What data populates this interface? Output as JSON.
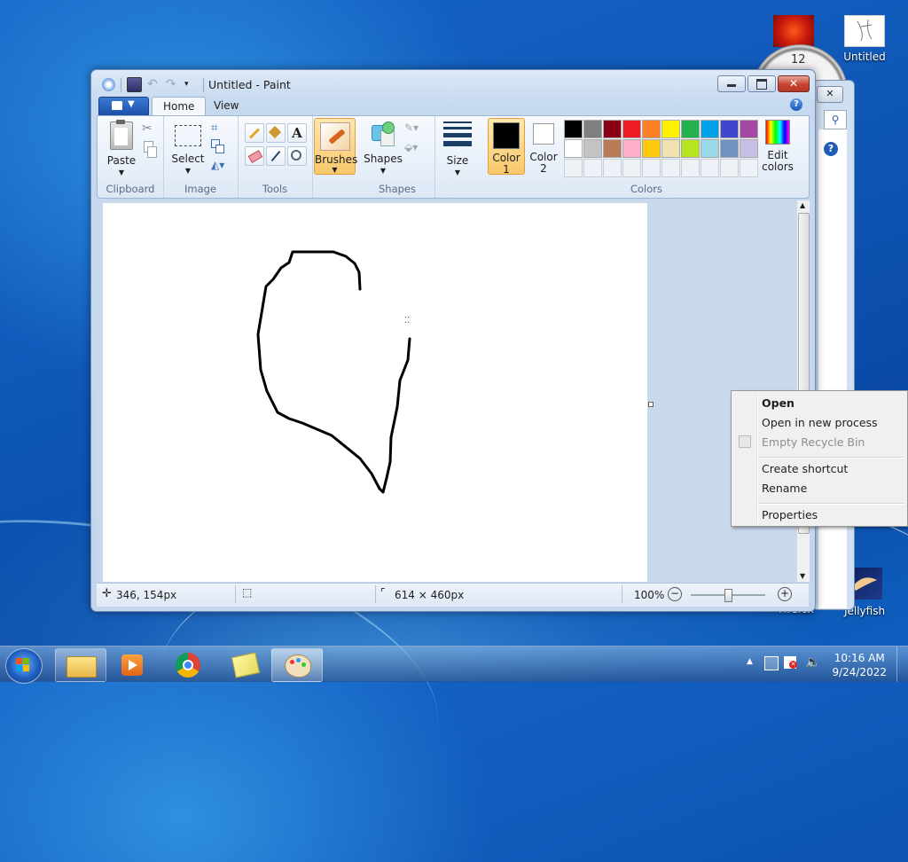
{
  "desktop": {
    "icons": [
      {
        "label": "Untitled"
      },
      {
        "label": "Firefox"
      },
      {
        "label": "Jellyfish"
      }
    ],
    "clock_gadget_number": "12"
  },
  "paint": {
    "window_title": "Untitled - Paint",
    "tabs": [
      "Home",
      "View"
    ],
    "groups": {
      "clipboard": {
        "label": "Clipboard",
        "paste": "Paste"
      },
      "image": {
        "label": "Image",
        "select": "Select"
      },
      "tools": {
        "label": "Tools"
      },
      "brushes": {
        "label": "Brushes"
      },
      "shapes": {
        "label": "Shapes",
        "shapes_btn": "Shapes"
      },
      "size": {
        "label": "Size"
      },
      "colors": {
        "label": "Colors",
        "color1": [
          "Color",
          "1"
        ],
        "color2": [
          "Color",
          "2"
        ],
        "edit_colors": [
          "Edit",
          "colors"
        ]
      }
    },
    "palette_row1": [
      "#000000",
      "#7f7f7f",
      "#880015",
      "#ed1c24",
      "#ff7f27",
      "#fff200",
      "#22b14c",
      "#00a2e8",
      "#3f48cc",
      "#a349a4"
    ],
    "palette_row2": [
      "#ffffff",
      "#c3c3c3",
      "#b97a57",
      "#ffaec9",
      "#ffc90e",
      "#efe4b0",
      "#b5e61d",
      "#99d9ea",
      "#7092be",
      "#c8bfe7"
    ],
    "status": {
      "cursor_pos": "346, 154px",
      "canvas_size": "614 × 460px",
      "zoom": "100%"
    }
  },
  "context_menu": {
    "items": [
      {
        "label": "Open",
        "bold": true,
        "enabled": true
      },
      {
        "label": "Open in new process",
        "enabled": true
      },
      {
        "label": "Empty Recycle Bin",
        "enabled": false
      },
      {
        "label": "Create shortcut",
        "enabled": true
      },
      {
        "label": "Rename",
        "enabled": true
      },
      {
        "label": "Properties",
        "enabled": true
      }
    ]
  },
  "taskbar": {
    "time": "10:16 AM",
    "date": "9/24/2022"
  }
}
